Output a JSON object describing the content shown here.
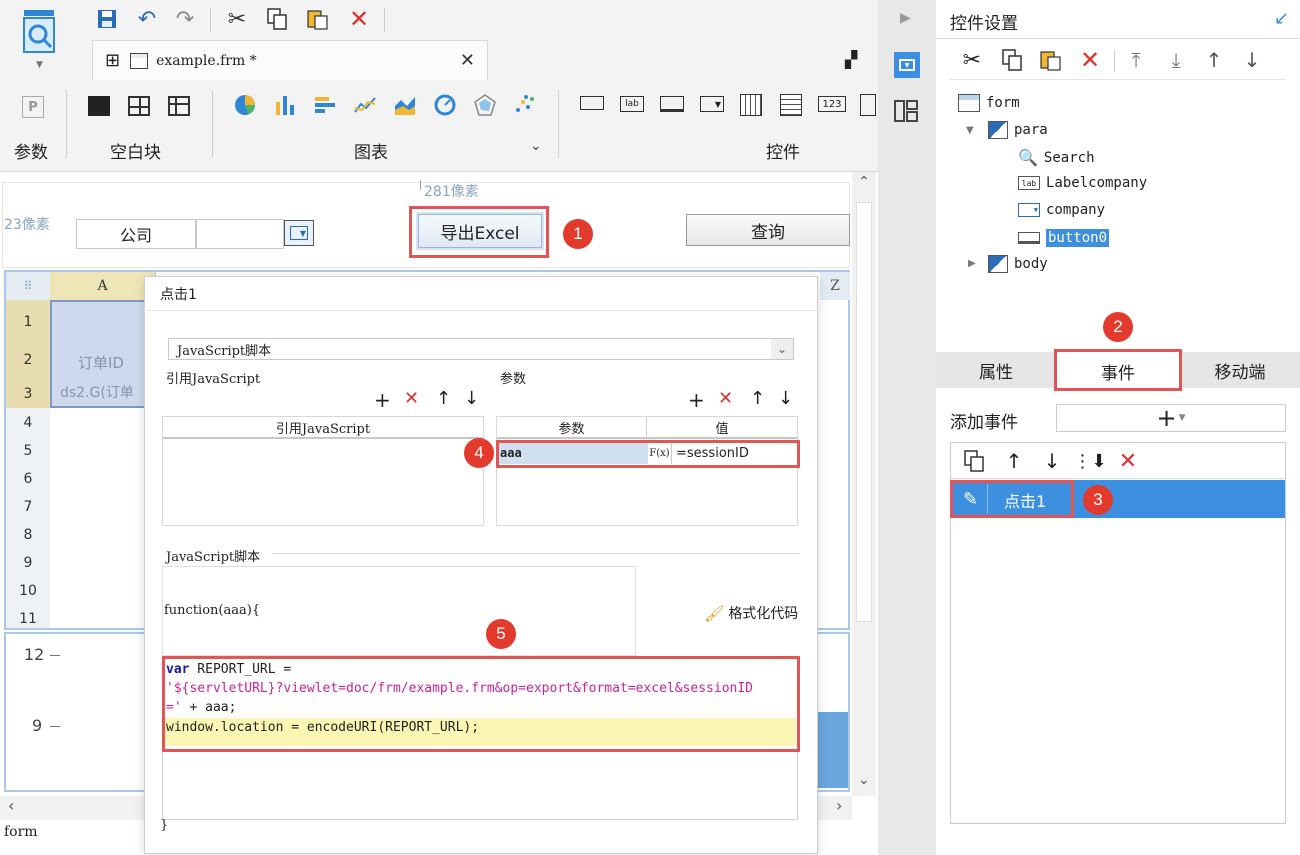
{
  "toolbar": {
    "labels": {
      "params": "参数",
      "blank": "空白块",
      "chart": "图表",
      "controls": "控件"
    },
    "file_tab": "example.frm *"
  },
  "canvas": {
    "ruler_top": "281像素",
    "ruler_left": "23像素",
    "company_label": "公司",
    "export_button": "导出Excel",
    "query_button": "查询",
    "col_a": "A",
    "col_z": "Z",
    "rows": [
      "1",
      "2",
      "3",
      "4",
      "5",
      "6",
      "7",
      "8",
      "9",
      "10",
      "11"
    ],
    "cell_order_id": "订单ID",
    "cell_formula": "ds2.G(订单",
    "chart_y1": "12",
    "chart_y2": "9",
    "status": "form"
  },
  "dialog": {
    "title": "点击1",
    "script_type": "JavaScript脚本",
    "ref_js_label": "引用JavaScript",
    "params_label": "参数",
    "ref_js_header": "引用JavaScript",
    "param_header": "参数",
    "value_header": "值",
    "param_name": "aaa",
    "fx": "F(x)",
    "param_value": "=sessionID",
    "js_script_label": "JavaScript脚本",
    "function_sig": "function(aaa){",
    "format_code": "格式化代码",
    "code": {
      "kw_var": "var",
      "line1_rest": " REPORT_URL =",
      "line2": "'${servletURL}?viewlet=doc/frm/example.frm&op=export&format=excel&sessionID",
      "line3_str": "='",
      "line3_rest": " + aaa;",
      "line4": "window.location = encodeURI(REPORT_URL);"
    },
    "closing_brace": "}"
  },
  "right": {
    "title": "控件设置",
    "tree": {
      "form": "form",
      "para": "para",
      "search": "Search",
      "labelcompany": "Labelcompany",
      "company": "company",
      "button0": "button0",
      "body": "body"
    },
    "tabs": {
      "props": "属性",
      "events": "事件",
      "mobile": "移动端"
    },
    "add_event": "添加事件",
    "event_item": "点击1"
  },
  "badges": [
    "1",
    "2",
    "3",
    "4",
    "5"
  ],
  "colors": {
    "accent": "#3a8ee6",
    "highlight": "#3d8fe0",
    "red": "#e25555"
  }
}
